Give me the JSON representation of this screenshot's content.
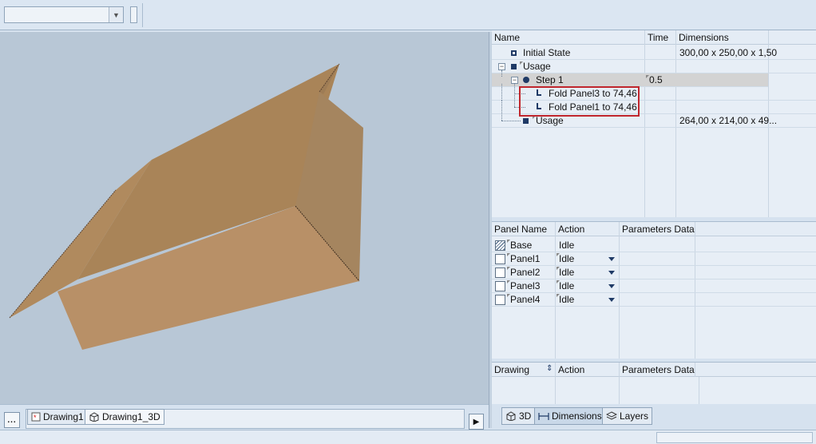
{
  "toolbar": {
    "combo_value": "",
    "combo_dropdown_icon": "chevron-down-icon"
  },
  "viewport": {
    "background_color": "#b8c7d6",
    "model_color": "#b68d63"
  },
  "document_tabs": [
    {
      "label": "Drawing1",
      "icon": "drawing-icon"
    },
    {
      "label": "Drawing1_3D",
      "icon": "cube-icon"
    }
  ],
  "more_button_label": "...",
  "play_icon": "play-icon",
  "steps_grid": {
    "headers": {
      "name": "Name",
      "time": "Time",
      "dimensions": "Dimensions"
    },
    "rows": [
      {
        "name": "Initial State",
        "time": "",
        "dimensions": "300,00 x 250,00 x 1,50"
      },
      {
        "name": "Usage",
        "time": "",
        "dimensions": ""
      },
      {
        "name": "Step 1",
        "time": "0.5",
        "dimensions": ""
      },
      {
        "name": "Fold Panel3 to 74,46",
        "time": "",
        "dimensions": ""
      },
      {
        "name": "Fold Panel1 to 74,46",
        "time": "",
        "dimensions": ""
      },
      {
        "name": "Usage",
        "time": "",
        "dimensions": "264,00 x 214,00 x 49..."
      }
    ]
  },
  "panels_grid": {
    "headers": {
      "panel_name": "Panel Name",
      "action": "Action",
      "parameters": "Parameters Data"
    },
    "rows": [
      {
        "name": "Base",
        "action": "Idle"
      },
      {
        "name": "Panel1",
        "action": "Idle"
      },
      {
        "name": "Panel2",
        "action": "Idle"
      },
      {
        "name": "Panel3",
        "action": "Idle"
      },
      {
        "name": "Panel4",
        "action": "Idle"
      }
    ]
  },
  "drawing_grid": {
    "headers": {
      "drawing": "Drawing",
      "action": "Action",
      "parameters": "Parameters Data"
    }
  },
  "bottom_tabs": [
    {
      "label": "3D",
      "icon": "cube-icon"
    },
    {
      "label": "Dimensions",
      "icon": "dimension-icon"
    },
    {
      "label": "Layers",
      "icon": "layers-icon"
    }
  ],
  "highlight_color": "#c0262d"
}
